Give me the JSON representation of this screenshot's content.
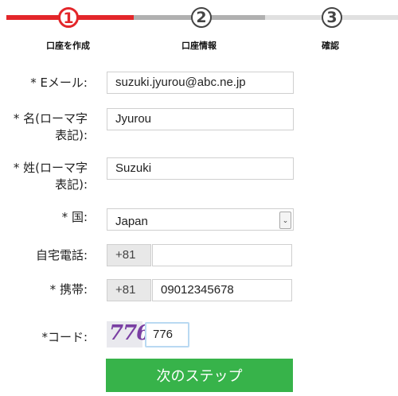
{
  "steps": [
    {
      "number": "1",
      "label": "口座を作成"
    },
    {
      "number": "2",
      "label": "口座情報"
    },
    {
      "number": "3",
      "label": "確認"
    }
  ],
  "form": {
    "email": {
      "label": "* Eメール:",
      "value": "suzuki.jyurou@abc.ne.jp"
    },
    "first_name": {
      "label_line1": "* 名(ローマ字",
      "label_line2": "表記):",
      "value": "Jyurou"
    },
    "last_name": {
      "label_line1": "* 姓(ローマ字",
      "label_line2": "表記):",
      "value": "Suzuki"
    },
    "country": {
      "label": "* 国:",
      "value": "Japan"
    },
    "home_phone": {
      "label": "自宅電話:",
      "prefix": "+81",
      "value": ""
    },
    "mobile": {
      "label": "* 携帯:",
      "prefix": "+81",
      "value": "09012345678"
    },
    "code": {
      "label": "*コード:",
      "captcha_text": "776",
      "value": "776"
    }
  },
  "submit_label": "次のステップ",
  "colors": {
    "accent": "#e3262a",
    "submit": "#37b34a",
    "captcha": "#7a3fa3"
  }
}
